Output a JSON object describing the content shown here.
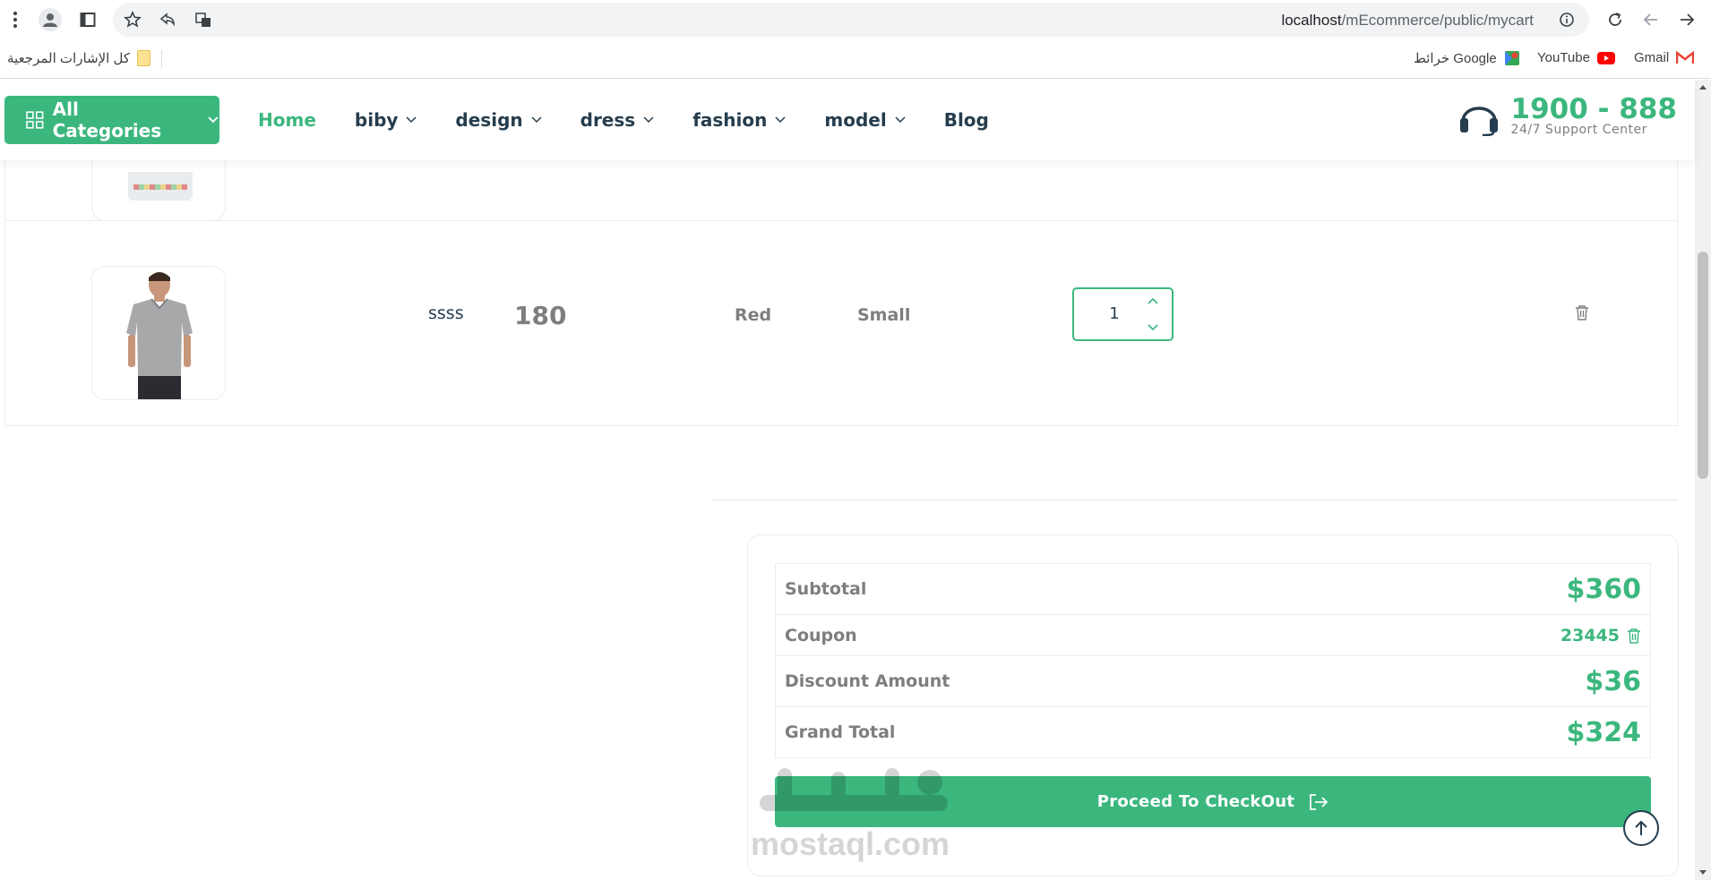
{
  "browser": {
    "url_host": "localhost",
    "url_path": "/mEcommerce/public/mycart",
    "bookmarks": {
      "all_bookmarks": "كل الإشارات المرجعية",
      "google_maps": "خرائط Google",
      "youtube": "YouTube",
      "gmail": "Gmail"
    }
  },
  "header": {
    "categories_button": "All Categories",
    "nav": [
      {
        "label": "Home",
        "active": true
      },
      {
        "label": "biby"
      },
      {
        "label": "design"
      },
      {
        "label": "dress"
      },
      {
        "label": "fashion"
      },
      {
        "label": "model"
      },
      {
        "label": "Blog"
      }
    ],
    "support_number": "1900 - 888",
    "support_label": "24/7 Support Center"
  },
  "cart": {
    "items": [
      {
        "name": "ssss",
        "price": "180",
        "color": "Red",
        "size": "Small",
        "quantity": "1"
      }
    ]
  },
  "totals": {
    "subtotal_label": "Subtotal",
    "subtotal_value": "$360",
    "coupon_label": "Coupon",
    "coupon_value": "23445",
    "discount_label": "Discount Amount",
    "discount_value": "$36",
    "grand_total_label": "Grand Total",
    "grand_total_value": "$324",
    "checkout_label": "Proceed To CheckOut"
  },
  "watermark": "mostaql.com",
  "colors": {
    "brand": "#3bb77e",
    "heading": "#253d4e",
    "muted": "#7e7e7e"
  }
}
